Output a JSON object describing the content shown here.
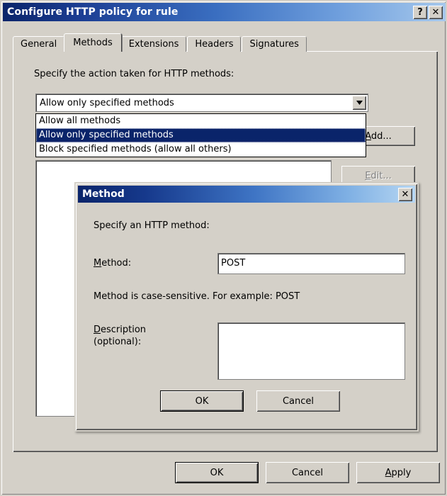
{
  "window": {
    "title": "Configure HTTP policy for rule",
    "help_button": "?",
    "close_button": "✕"
  },
  "tabs": [
    {
      "label": "General",
      "active": false
    },
    {
      "label": "Methods",
      "active": true
    },
    {
      "label": "Extensions",
      "active": false
    },
    {
      "label": "Headers",
      "active": false
    },
    {
      "label": "Signatures",
      "active": false
    }
  ],
  "methods_panel": {
    "instruction": "Specify the action taken for HTTP methods:",
    "combo": {
      "selected_value": "Allow only specified methods",
      "arrow_icon": "chevron-down-icon",
      "expanded": true,
      "options": [
        "Allow all methods",
        "Allow only specified methods",
        "Block specified methods (allow all others)"
      ],
      "selected_index": 1
    },
    "add_button": {
      "label": "Add...",
      "accesskey": "A",
      "enabled": true
    },
    "edit_button": {
      "label": "Edit...",
      "accesskey": "E",
      "enabled": false
    }
  },
  "footer": {
    "ok_label": "OK",
    "cancel_label": "Cancel",
    "apply_label": "Apply",
    "apply_accesskey": "A"
  },
  "method_dialog": {
    "title": "Method",
    "close_button": "✕",
    "instruction": "Specify an HTTP method:",
    "method_label": "Method:",
    "method_label_accesskey": "M",
    "method_value": "POST",
    "method_placeholder": "",
    "note": "Method is case-sensitive. For example: POST",
    "description_label_line1": "Description",
    "description_label_line2": "(optional):",
    "description_accesskey": "D",
    "description_value": "",
    "description_placeholder": "",
    "ok_label": "OK",
    "cancel_label": "Cancel"
  },
  "colors": {
    "face": "#d4d0c8",
    "title_gradient_start": "#0a246a",
    "title_gradient_end": "#a6c8ec",
    "highlight": "#0a246a",
    "highlight_text": "#ffffff",
    "window_bg": "#ffffff",
    "disabled_text": "#808080"
  }
}
